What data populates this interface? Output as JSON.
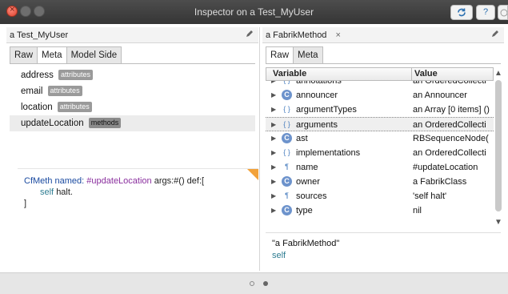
{
  "window": {
    "title": "Inspector on a Test_MyUser",
    "refresh_icon": "refresh-icon",
    "help_label": "?"
  },
  "left_pane": {
    "header": "a Test_MyUser",
    "tabs": [
      "Raw",
      "Meta",
      "Model Side"
    ],
    "active_tab": "Meta",
    "attributes": [
      {
        "name": "address",
        "badge": "attributes"
      },
      {
        "name": "email",
        "badge": "attributes"
      },
      {
        "name": "location",
        "badge": "attributes"
      },
      {
        "name": "updateLocation",
        "badge": "methods",
        "selected": true
      }
    ],
    "code": {
      "class": "CfMeth",
      "named": "named:",
      "symbol": "#updateLocation",
      "args": "args:#() def:[",
      "self": "self",
      "halt": "halt.",
      "close": "]"
    }
  },
  "right_pane": {
    "header": "a FabrikMethod",
    "close": "×",
    "tabs": [
      "Raw",
      "Meta"
    ],
    "active_tab": "Raw",
    "columns": [
      "Variable",
      "Value"
    ],
    "rows": [
      {
        "icon": "braces",
        "name": "annotations",
        "value": "an OrderedCollecti"
      },
      {
        "icon": "c",
        "name": "announcer",
        "value": "an Announcer"
      },
      {
        "icon": "braces",
        "name": "argumentTypes",
        "value": "an Array [0 items] ()"
      },
      {
        "icon": "braces",
        "name": "arguments",
        "value": "an OrderedCollecti",
        "selected": true
      },
      {
        "icon": "c",
        "name": "ast",
        "value": "RBSequenceNode("
      },
      {
        "icon": "braces",
        "name": "implementations",
        "value": "an OrderedCollecti"
      },
      {
        "icon": "pilcrow",
        "name": "name",
        "value": "#updateLocation"
      },
      {
        "icon": "c",
        "name": "owner",
        "value": "a FabrikClass"
      },
      {
        "icon": "pilcrow",
        "name": "sources",
        "value": "'self halt'"
      },
      {
        "icon": "c",
        "name": "type",
        "value": "nil"
      }
    ],
    "eval": {
      "line1": "\"a FabrikMethod\"",
      "line2": "self"
    }
  }
}
